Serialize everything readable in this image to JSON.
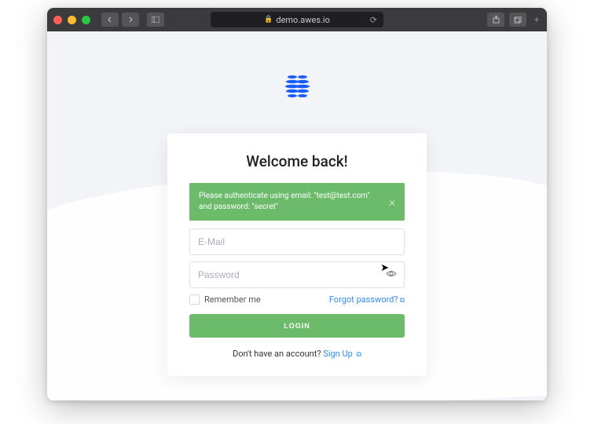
{
  "browser": {
    "url": "demo.awes.io"
  },
  "login": {
    "title": "Welcome back!",
    "alert_text": "Please authenticate using email: \"test@test.com\" and password: \"secret\"",
    "email_placeholder": "E-Mail",
    "password_placeholder": "Password",
    "remember_label": "Remember me",
    "forgot_label": "Forgot password?",
    "submit_label": "LOGIN",
    "signup_prompt": "Don't have an account?",
    "signup_link": "Sign Up"
  },
  "colors": {
    "accent_green": "#6bbb6a",
    "link_blue": "#2c8fef",
    "logo_blue": "#1b5ef7"
  }
}
